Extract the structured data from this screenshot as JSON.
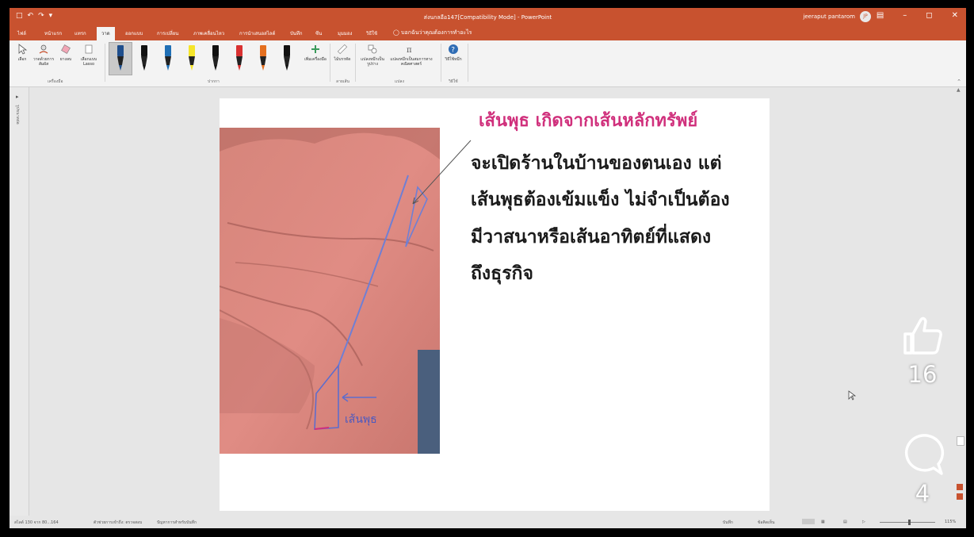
{
  "window": {
    "title": "ส่งนกลอือ147[Compatibility Mode] - PowerPoint",
    "user": "jeeraput pantarom",
    "user_initials": "JP",
    "accent_color": "#c8522f"
  },
  "quick_access": [
    "save-icon",
    "undo-icon",
    "redo-icon",
    "more-icon"
  ],
  "tabs": [
    {
      "label": "ไฟล์"
    },
    {
      "label": "หน้าแรก"
    },
    {
      "label": "แทรก"
    },
    {
      "label": "วาด",
      "active": true
    },
    {
      "label": "ออกแบบ"
    },
    {
      "label": "การเปลี่ยน"
    },
    {
      "label": "ภาพเคลื่อนไหว"
    },
    {
      "label": "การนำเสนอสไลด์"
    },
    {
      "label": "บันทึก"
    },
    {
      "label": "ซีน"
    },
    {
      "label": "มุมมอง"
    },
    {
      "label": "วิธีใช้"
    }
  ],
  "tell_me": "บอกฉันว่าคุณต้องการทำอะไร",
  "ribbon": {
    "tools": [
      {
        "label": "เลือก",
        "icon": "cursor-icon"
      },
      {
        "label": "วาดด้วยการสัมผัส",
        "icon": "touch-draw-icon"
      },
      {
        "label": "ยางลบ",
        "icon": "eraser-icon"
      },
      {
        "label": "เลือกแบบ Lasso",
        "icon": "lasso-icon"
      }
    ],
    "tools_group": "เครื่องมือ",
    "pens": [
      {
        "color": "#1f4e8c"
      },
      {
        "color": "#111111"
      },
      {
        "color": "#1f6fb5"
      },
      {
        "color": "#f5e52a"
      },
      {
        "color": "#111111"
      },
      {
        "color": "#d93131"
      },
      {
        "color": "#e46f1f"
      },
      {
        "color": "#111111"
      }
    ],
    "add_pen": "เพิ่มเครื่องมือ",
    "pens_group": "ปากกา",
    "ruler": "ไม้บรรทัด",
    "stencils_group": "ลายเส้น",
    "ink_to_shape": "แปลงหมึกเป็นรูปร่าง",
    "ink_to_math": "แปลงหมึกเป็นสมการทางคณิตศาสตร์",
    "convert_group": "แปลง",
    "help": "วิธีใช้หมึก",
    "help_group": "วิธีใช้"
  },
  "left_panel": {
    "label": "รูปขนาดย่อ"
  },
  "slide": {
    "title": "เส้นพุธ เกิดจากเส้นหลักทรัพย์",
    "lines": [
      "จะเปิดร้านในบ้านของตนเอง แต่",
      "เส้นพุธต้องเข้มแข็ง ไม่จำเป็นต้อง",
      "มีวาสนาหรือเส้นอาทิตย์ที่แสดง",
      "ถึงธุรกิจ"
    ],
    "handwriting": "เส้นพุธ"
  },
  "status": {
    "slide_info": "สไลด์ 130 จาก 80...164",
    "accessibility": "ตัวช่วยการเข้าถึง: ตรวจสอบ",
    "hint": "ปัญหาการสำหรับบันทึก",
    "notes": "บันทึก",
    "comments": "ข้อคิดเห็น",
    "zoom": "115%"
  },
  "overlay": {
    "likes": "16",
    "comments": "4"
  }
}
